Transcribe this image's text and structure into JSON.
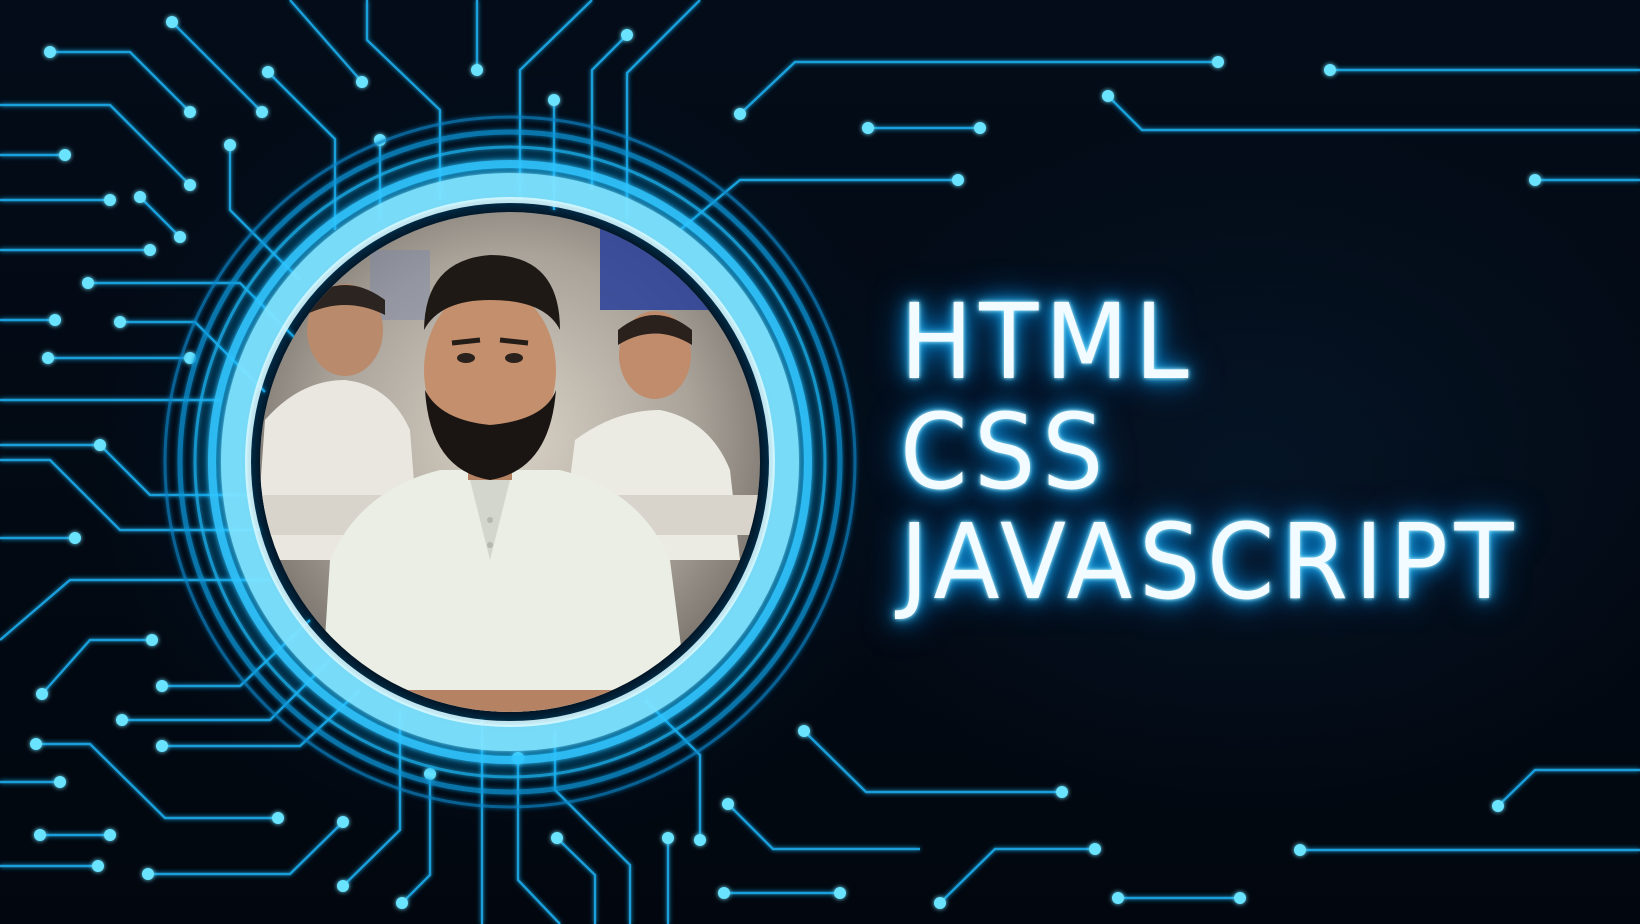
{
  "image": {
    "kind": "promotional thumbnail",
    "subject": "portrait-photo",
    "accent_color": "#19c3ff",
    "background_color": "#02070f",
    "text_glow_color": "#0aa7ff"
  },
  "headline": {
    "line1": "HTML",
    "line2": "CSS",
    "line3": "JAVASCRIPT"
  }
}
